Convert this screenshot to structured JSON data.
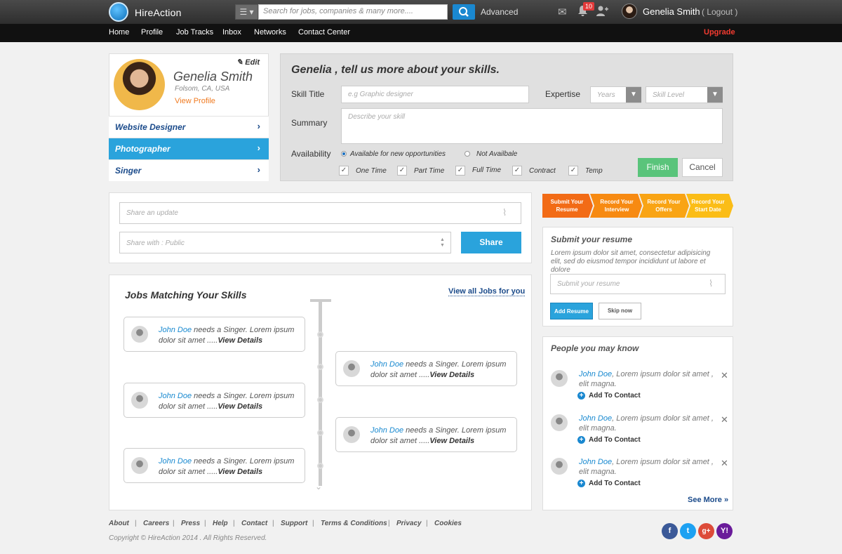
{
  "brand": {
    "name": "HireAction"
  },
  "header": {
    "search_placeholder": "Search for jobs, companies & many more....",
    "advanced": "Advanced",
    "notifications_count": "10",
    "user_name": "Genelia Smith",
    "logout": "( Logout )"
  },
  "nav": {
    "items": [
      "Home",
      "Profile",
      "Job Tracks",
      "Inbox",
      "Networks",
      "Contact Center"
    ],
    "upgrade": "Upgrade"
  },
  "profile": {
    "edit": "Edit",
    "name": "Genelia Smith",
    "location": "Folsom, CA, USA",
    "view_profile": "View Profile",
    "roles": [
      "Website Designer",
      "Photographer",
      "Singer"
    ],
    "active_role": "Photographer"
  },
  "skills_form": {
    "title": "Genelia , tell us more about your skills.",
    "skill_title_label": "Skill Title",
    "skill_title_placeholder": "e.g Graphic designer",
    "expertise_label": "Expertise",
    "years_placeholder": "Years",
    "level_placeholder": "Skill Level",
    "summary_label": "Summary",
    "summary_placeholder": "Describe your skill",
    "availability_label": "Availability",
    "radio_available": "Available for new opportunities",
    "radio_not": "Not Availbale",
    "checks": [
      "One Time",
      "Part Time",
      "Full Time",
      "Contract",
      "Temp"
    ],
    "finish": "Finish",
    "cancel": "Cancel"
  },
  "share": {
    "update_placeholder": "Share an update",
    "with_placeholder": "Share with : Public",
    "button": "Share"
  },
  "jobs": {
    "title": "Jobs Matching Your Skills",
    "view_all": "View all Jobs for you",
    "items": [
      {
        "name": "John Doe",
        "text": "needs a Singer. Lorem ipsum dolor sit amet .....",
        "link": "View Details"
      },
      {
        "name": "John Doe",
        "text": "needs a Singer. Lorem ipsum dolor sit amet .....",
        "link": "View Details"
      },
      {
        "name": "John Doe",
        "text": "needs a Singer. Lorem ipsum dolor sit amet .....",
        "link": "View Details"
      },
      {
        "name": "John Doe",
        "text": "needs a Singer. Lorem ipsum dolor sit amet .....",
        "link": "View Details"
      },
      {
        "name": "John Doe",
        "text": "needs a Singer. Lorem ipsum dolor sit amet .....",
        "link": "View Details"
      }
    ]
  },
  "steps": [
    {
      "line1": "Submit Your",
      "line2": "Resume",
      "color": "#f26b16"
    },
    {
      "line1": "Record Your",
      "line2": "Interview",
      "color": "#f78a12"
    },
    {
      "line1": "Record Your",
      "line2": "Offers",
      "color": "#f9a414"
    },
    {
      "line1": "Record Your",
      "line2": "Start Date",
      "color": "#fbbd17"
    }
  ],
  "resume": {
    "title": "Submit your resume",
    "description": "Lorem ipsum dolor sit amet, consectetur adipisicing elit, sed do eiusmod tempor incididunt ut labore et dolore",
    "placeholder": "Submit your resume",
    "add": "Add Resume",
    "skip": "Skip now"
  },
  "people": {
    "title": "People you may know",
    "items": [
      {
        "name": "John Doe",
        "text": ",  Lorem ipsum dolor sit amet , elit magna.",
        "action": "Add To Contact"
      },
      {
        "name": "John Doe",
        "text": ",  Lorem ipsum dolor sit amet , elit magna.",
        "action": "Add To Contact"
      },
      {
        "name": "John Doe",
        "text": ",  Lorem ipsum dolor sit amet , elit magna.",
        "action": "Add To Contact"
      }
    ],
    "see_more": "See More »"
  },
  "footer": {
    "links": [
      "About",
      "Careers",
      "Press",
      "Help",
      "Contact",
      "Support",
      "Terms & Conditions",
      "Privacy",
      "Cookies"
    ],
    "copyright": "Copyright © HireAction 2014 . All Rights Reserved."
  },
  "colors": {
    "accent": "#2aa3dc",
    "orange": "#f07b22",
    "upgrade": "#f33b30",
    "finish": "#5ac47b"
  }
}
